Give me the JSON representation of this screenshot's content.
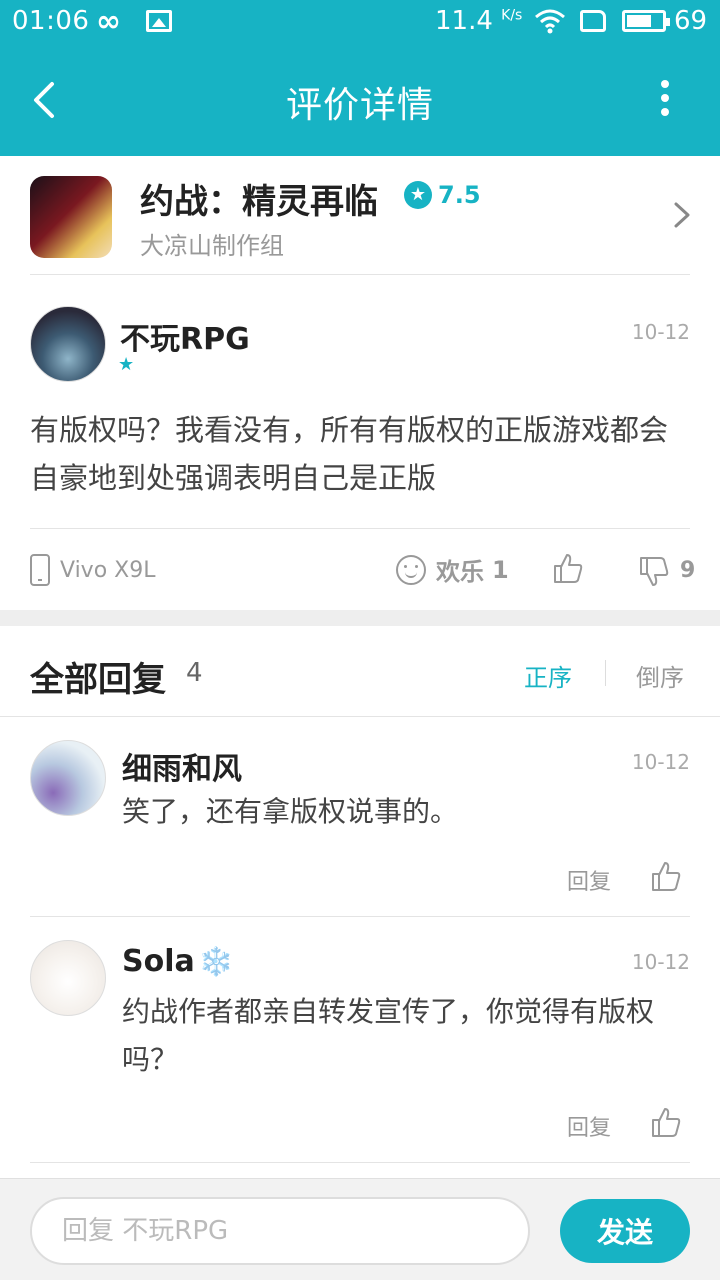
{
  "status_bar": {
    "time": "01:06",
    "speed": "11.4",
    "speed_unit": "K/s",
    "battery": "69"
  },
  "nav": {
    "title": "评价详情"
  },
  "game": {
    "name": "约战：精灵再临",
    "rating": "7.5",
    "developer": "大凉山制作组"
  },
  "review": {
    "user": "不玩RPG",
    "date": "10-12",
    "content": "有版权吗？我看没有，所有有版权的正版游戏都会自豪地到处强调表明自己是正版",
    "device": "Vivo X9L",
    "mood_label": "欢乐",
    "mood_count": "1",
    "dislike_count": "9"
  },
  "replies": {
    "title": "全部回复",
    "count": "4",
    "sort_asc": "正序",
    "sort_desc": "倒序",
    "reply_label": "回复",
    "items": [
      {
        "name": "细雨和风",
        "date": "10-12",
        "text": "笑了，还有拿版权说事的。"
      },
      {
        "name": "Sola",
        "badge": "❄️",
        "date": "10-12",
        "text": "约战作者都亲自转发宣传了，你觉得有版权吗？"
      }
    ]
  },
  "composer": {
    "placeholder": "回复 不玩RPG",
    "send_label": "发送"
  },
  "colors": {
    "accent": "#17b3c4"
  }
}
